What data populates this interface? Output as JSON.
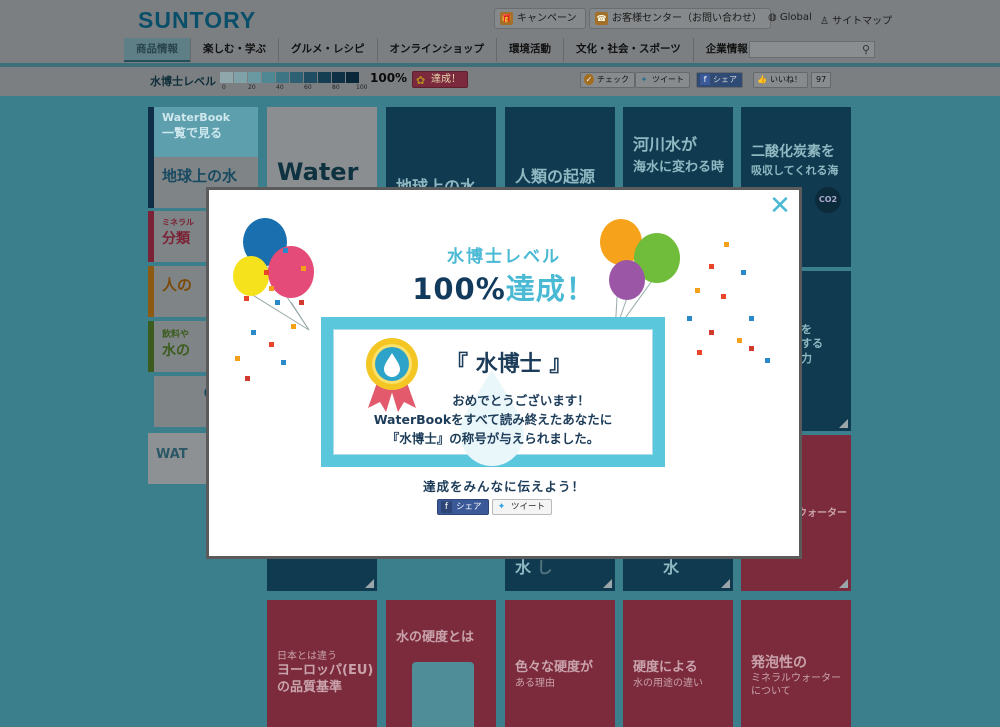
{
  "header": {
    "logo": "SUNTORY",
    "campaign_label": "キャンペーン",
    "support_label": "お客様センター（お問い合わせ）",
    "global_label": "Global",
    "sitemap_label": "サイトマップ",
    "nav": [
      "商品情報",
      "楽しむ・学ぶ",
      "グルメ・レシピ",
      "オンラインショップ",
      "環境活動",
      "文化・社会・スポーツ",
      "企業情報"
    ]
  },
  "level_bar": {
    "label": "水博士レベル",
    "ticks": [
      "0",
      "20",
      "40",
      "60",
      "80",
      "100"
    ],
    "progress": 1.0,
    "percent": "100%",
    "badge": "達成！",
    "check_label": "チェック",
    "tweet_label": "ツイート",
    "share_label": "シェア",
    "like_label": "いいね！",
    "like_count": "97"
  },
  "background_tiles": {
    "side1": "WaterBook",
    "side1b": "一覧で見る",
    "side2": "地球上の水",
    "side3a": "ミネラル",
    "side3b": "分類",
    "side4": "人の",
    "side5a": "飲料や",
    "side5b": "水の",
    "side6": "Q",
    "side7": "WAT",
    "t_water": "Water",
    "t_earth": "地球上の水",
    "t_origin": "人類の起源",
    "t_river_a": "河川水が",
    "t_river_b": "海水に変わる時",
    "t_co2_a": "二酸化炭素を",
    "t_co2_b": "吸収してくれる海",
    "t_co2_badge": "CO2",
    "t_right_a": "を",
    "t_right_b": "する",
    "t_right_c": "力",
    "t_pink_right": "ウォーター",
    "t_mid_a": "水",
    "t_mid_b": "し",
    "t_mid_c": "水",
    "p1_a": "日本とは違う",
    "p1_b": "ヨーロッパ(EU)",
    "p1_c": "の品質基準",
    "p2_a": "水の硬度とは",
    "p3_a": "色々な硬度が",
    "p3_b": "ある理由",
    "p4_a": "硬度による",
    "p4_b": "水の用途の違い",
    "p5_a": "発泡性の",
    "p5_b": "ミネラルウォーター",
    "p5_c": "について"
  },
  "modal": {
    "title": "水博士レベル",
    "percent": "100%",
    "achieved": "達成！",
    "cert_name": "『 水博士 』",
    "cert_line1": "おめでとうございます！",
    "cert_line2": "WaterBookをすべて読み終えたあなたに",
    "cert_line3": "『水博士』の称号が与えられました。",
    "share_heading": "達成をみんなに伝えよう！",
    "share_button": "シェア",
    "tweet_button": "ツイート",
    "close_glyph": "✕"
  },
  "colors": {
    "accent": "#49b9d4",
    "navy": "#1d3c59",
    "overlay_bg": "#3b7f8c",
    "pink_tile": "#7c2b3d",
    "navy_tile": "#103a4f"
  }
}
